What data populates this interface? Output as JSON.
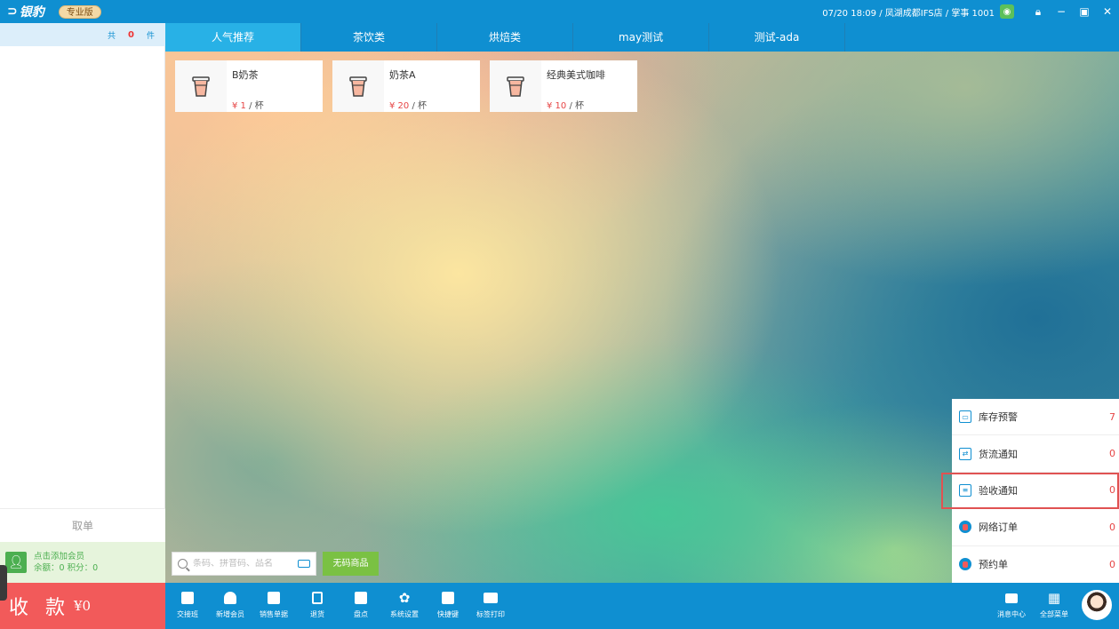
{
  "titlebar": {
    "logo_text": "银豹",
    "edition_badge": "专业版",
    "status": "07/20 18:09 / 凤湖成都IFS店 / 掌事 1001"
  },
  "cart": {
    "total_prefix": "共",
    "count": "0",
    "unit": "件",
    "cancel_label": "取单",
    "member_add": "点击添加会员",
    "member_balance": "余额：0  积分：0",
    "pay_label": "收 款",
    "pay_amount": "¥0"
  },
  "tabs": [
    {
      "label": "人气推荐",
      "active": true
    },
    {
      "label": "茶饮类",
      "active": false
    },
    {
      "label": "烘焙类",
      "active": false
    },
    {
      "label": "may测试",
      "active": false
    },
    {
      "label": "测试-ada",
      "active": false
    }
  ],
  "products": [
    {
      "name": "B奶茶",
      "price": "¥ 1",
      "unit": " / 杯",
      "icon": "cup-icon"
    },
    {
      "name": "奶茶A",
      "price": "¥ 20",
      "unit": " / 杯",
      "icon": "cup-icon"
    },
    {
      "name": "经典美式咖啡",
      "price": "¥ 10",
      "unit": " / 杯",
      "icon": "cup-icon"
    }
  ],
  "search": {
    "placeholder": "条码、拼音码、品名",
    "no_code_label": "无码商品"
  },
  "notifications": [
    {
      "label": "库存预警",
      "count": "7",
      "icon": "inventory-icon"
    },
    {
      "label": "货流通知",
      "count": "0",
      "icon": "transfer-icon"
    },
    {
      "label": "验收通知",
      "count": "0",
      "icon": "receipt-icon",
      "highlighted": true
    },
    {
      "label": "网络订单",
      "count": "0",
      "icon": "online-order-icon"
    },
    {
      "label": "预约单",
      "count": "0",
      "icon": "reservation-icon"
    }
  ],
  "toolbar": {
    "items": [
      {
        "label": "交接班",
        "icon": "handover-icon"
      },
      {
        "label": "新增会员",
        "icon": "add-member-icon"
      },
      {
        "label": "销售单据",
        "icon": "sales-receipt-icon"
      },
      {
        "label": "退货",
        "icon": "return-icon"
      },
      {
        "label": "盘点",
        "icon": "stocktake-icon"
      },
      {
        "label": "系统设置",
        "icon": "settings-icon"
      },
      {
        "label": "快捷键",
        "icon": "shortcut-icon"
      },
      {
        "label": "标签打印",
        "icon": "print-icon"
      }
    ],
    "right_items": [
      {
        "label": "消息中心",
        "icon": "message-icon"
      },
      {
        "label": "全部菜单",
        "icon": "menu-grid-icon"
      }
    ]
  },
  "colors": {
    "primary": "#0f8fd1",
    "tab_active": "#28b1e6",
    "pay": "#f25a5a",
    "price": "#e64545",
    "green": "#7ac143"
  }
}
